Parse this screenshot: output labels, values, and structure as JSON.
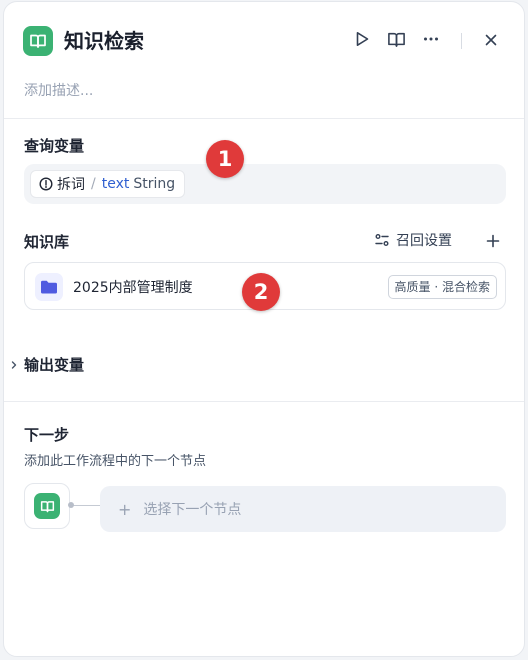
{
  "header": {
    "title": "知识检索",
    "description_placeholder": "添加描述..."
  },
  "query": {
    "section_title": "查询变量",
    "variable": {
      "source": "拆词",
      "separator": "/",
      "name": "text",
      "type": "String"
    }
  },
  "knowledge": {
    "section_title": "知识库",
    "recall_settings_label": "召回设置",
    "items": [
      {
        "name": "2025内部管理制度",
        "tag": "高质量 · 混合检索"
      }
    ]
  },
  "output": {
    "section_title": "输出变量"
  },
  "next_step": {
    "section_title": "下一步",
    "subtitle": "添加此工作流程中的下一个节点",
    "select_label": "选择下一个节点",
    "plus": "+"
  },
  "markers": [
    "1",
    "2"
  ],
  "colors": {
    "app_icon": "#3bb273",
    "marker": "#e03a3a",
    "variable": "#2f5fd0",
    "folder": "#4f5be0"
  }
}
